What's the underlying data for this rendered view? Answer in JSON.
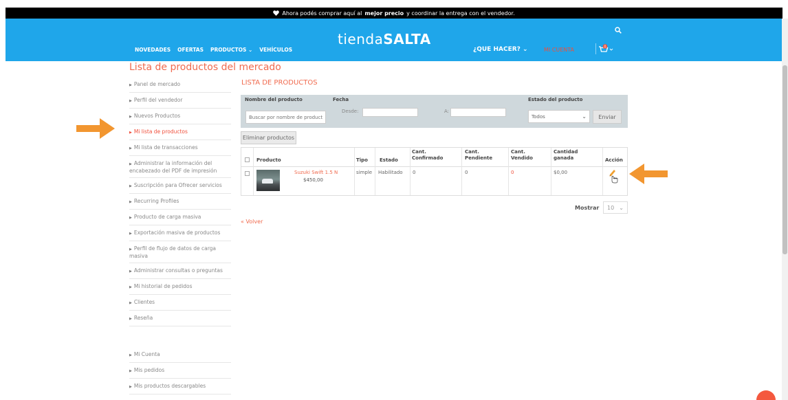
{
  "announcement": {
    "prefix": "Ahora podés comprar aquí al",
    "bold": "mejor precio",
    "suffix": "y coordinar la entrega con el vendedor."
  },
  "header": {
    "logo_part1": "tienda",
    "logo_part2": "SALTA",
    "nav": [
      "NOVEDADES",
      "OFERTAS",
      "PRODUCTOS ⌄",
      "VEHÍCULOS"
    ],
    "que_hacer": "¿QUE HACER?  ⌄",
    "mi_cuenta": "MI CUENTA",
    "cart_count": "0"
  },
  "page_title": "Lista de productos del mercado",
  "sidebar": {
    "items": [
      "Panel de mercado",
      "Perfil del vendedor",
      "Nuevos Productos",
      "Mi lista de productos",
      "Mi lista de transacciones",
      "Administrar la información del encabezado del PDF de impresión",
      "Suscripción para Ofrecer servicios",
      "Recurring Profiles",
      "Producto de carga masiva",
      "Exportación masiva de productos",
      "Perfil de flujo de datos de carga masiva",
      "Administrar consultas o preguntas",
      "Mi historial de pedidos",
      "Clientes",
      "Reseña"
    ],
    "account_items": [
      "Mi Cuenta",
      "Mis pedidos",
      "Mis productos descargables"
    ]
  },
  "main": {
    "section_title": "LISTA DE PRODUCTOS",
    "filter": {
      "h_name": "Nombre del producto",
      "h_date": "Fecha",
      "h_state": "Estado del producto",
      "search_placeholder": "Buscar por nombre de producto",
      "desde": "Desde:",
      "hasta": "A:",
      "state_value": "Todos",
      "enviar": "Enviar"
    },
    "delete_button": "Eliminar productos",
    "table": {
      "headers": [
        "Producto",
        "Tipo",
        "Estado",
        "Cant. Confirmado",
        "Cant. Pendiente",
        "Cant. Vendido",
        "Cantidad ganada",
        "Acción"
      ],
      "row": {
        "name": "Suzuki Swift 1.5 N",
        "price": "$450,00",
        "type": "simple",
        "state": "Habilitado",
        "confirmed": "0",
        "pending": "0",
        "sold": "0",
        "earned": "$0,00"
      }
    },
    "mostrar_label": "Mostrar",
    "mostrar_value": "10",
    "volver": "« Volver"
  },
  "colors": {
    "header_blue": "#1fa6ea",
    "accent_orange": "#f06a4e",
    "arrow_orange": "#f29630"
  }
}
